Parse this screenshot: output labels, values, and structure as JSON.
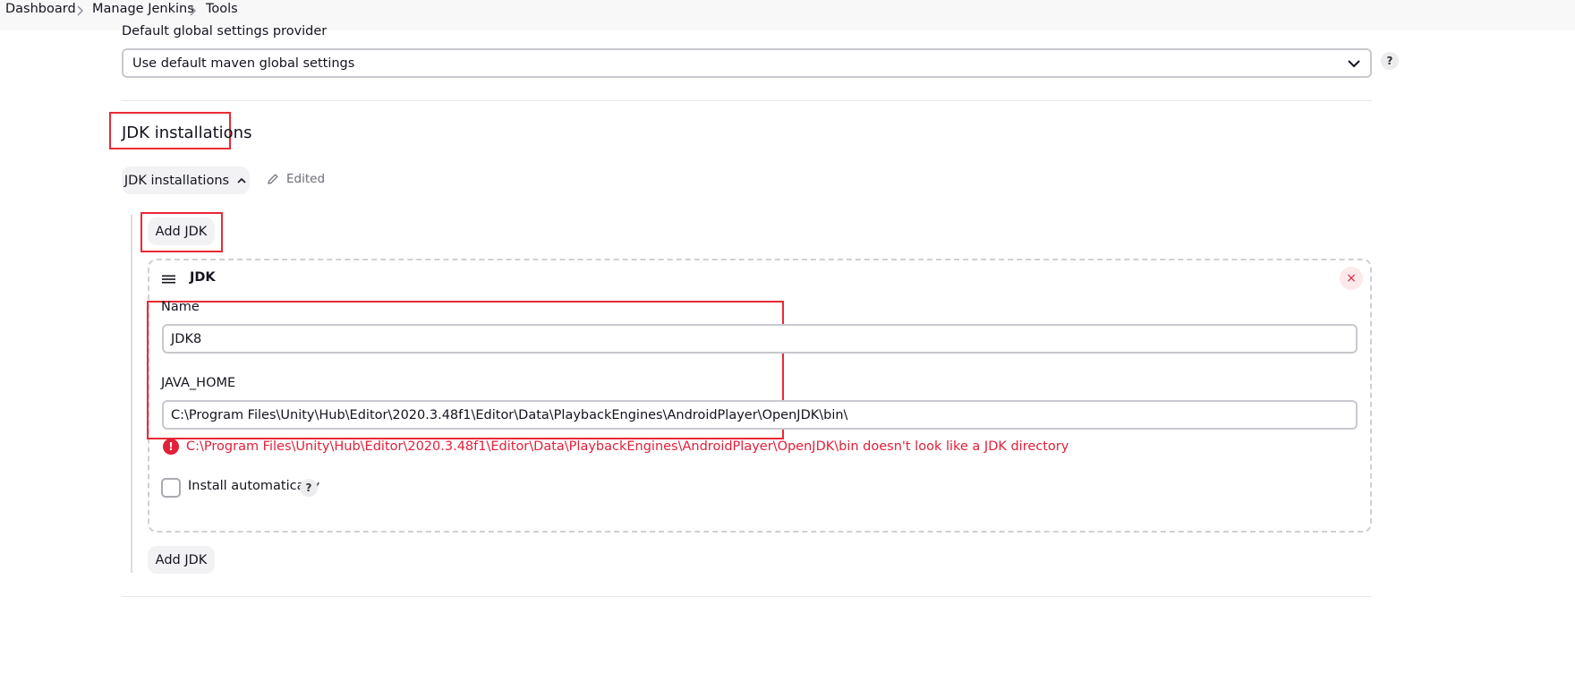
{
  "breadcrumb": {
    "items": [
      "Dashboard",
      "Manage Jenkins",
      "Tools"
    ]
  },
  "maven": {
    "settings_label": "Default global settings provider",
    "settings_value": "Use default maven global settings",
    "help": "?"
  },
  "jdk_section": {
    "title": "JDK installations",
    "toggle_label": "JDK installations",
    "edited_label": "Edited",
    "add_button": "Add JDK",
    "card": {
      "title": "JDK",
      "name_label": "Name",
      "name_value": "JDK8",
      "java_home_label": "JAVA_HOME",
      "java_home_value": "C:\\Program Files\\Unity\\Hub\\Editor\\2020.3.48f1\\Editor\\Data\\PlaybackEngines\\AndroidPlayer\\OpenJDK\\bin\\",
      "error_message": "C:\\Program Files\\Unity\\Hub\\Editor\\2020.3.48f1\\Editor\\Data\\PlaybackEngines\\AndroidPlayer\\OpenJDK\\bin doesn't look like a JDK directory",
      "install_auto_label": "Install automatically",
      "install_auto_checked": false,
      "help": "?",
      "close_symbol": "×"
    }
  },
  "colors": {
    "highlight_box": "#ea2a35",
    "error": "#e2203a",
    "breadcrumb_bg": "#f8f8f9"
  },
  "icons": [
    "chevron-right-icon",
    "chevron-down-icon",
    "chevron-up-icon",
    "pencil-icon",
    "drag-handle-icon",
    "close-icon",
    "error-icon"
  ]
}
